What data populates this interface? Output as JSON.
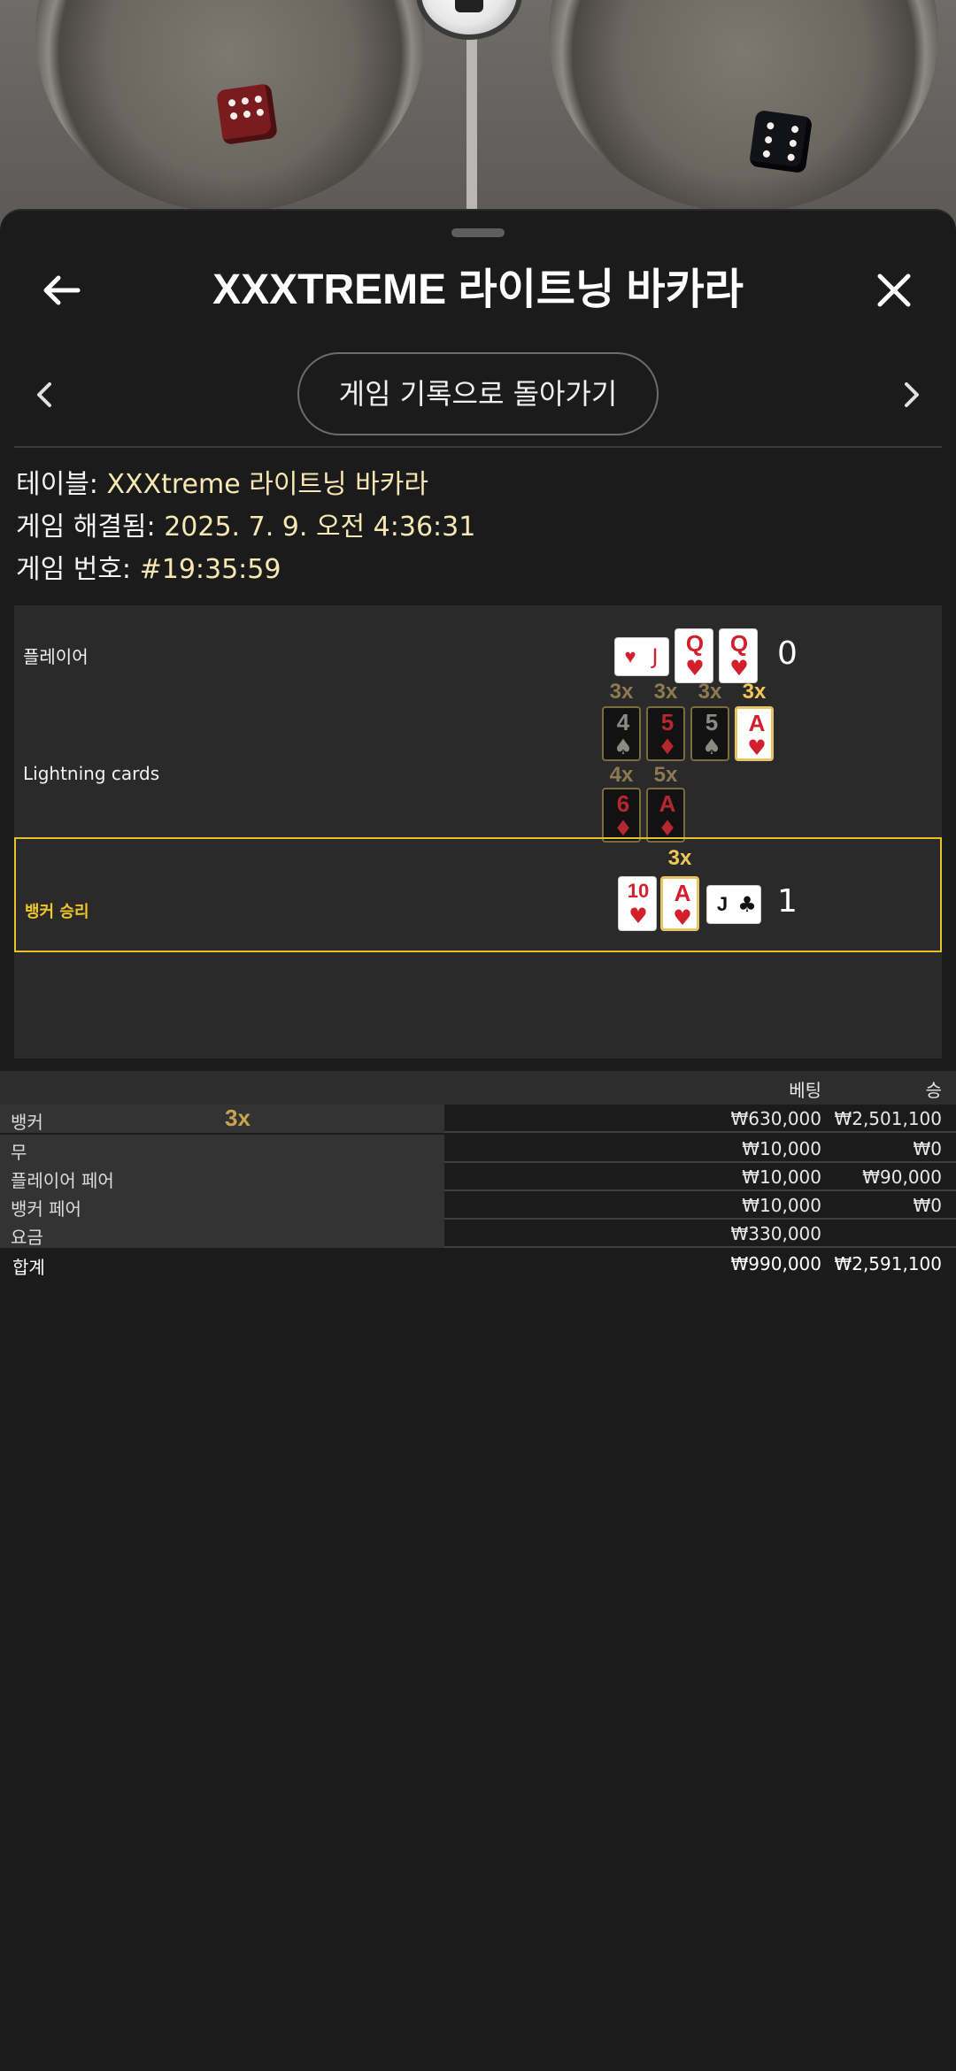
{
  "header": {
    "title": "XXXTREME 라이트닝 바카라"
  },
  "nav": {
    "history_button": "게임 기록으로 돌아가기"
  },
  "info": {
    "table_label": "테이블:",
    "table_value": "XXXtreme 라이트닝 바카라",
    "resolved_label": "게임 해결됨:",
    "resolved_value": "2025. 7. 9. 오전 4:36:31",
    "game_no_label": "게임 번호:",
    "game_no_value": "#19:35:59"
  },
  "result": {
    "player": {
      "label": "플레이어",
      "score": "0",
      "cards": [
        {
          "rank": "J",
          "suit": "♥",
          "color": "red",
          "orientation": "sideways"
        },
        {
          "rank": "Q",
          "suit": "♥",
          "color": "red"
        },
        {
          "rank": "Q",
          "suit": "♥",
          "color": "red"
        }
      ]
    },
    "lightning": {
      "label": "Lightning cards",
      "row1": [
        {
          "mult": "3x",
          "rank": "4",
          "suit": "♠",
          "color": "black"
        },
        {
          "mult": "3x",
          "rank": "5",
          "suit": "♦",
          "color": "red"
        },
        {
          "mult": "3x",
          "rank": "5",
          "suit": "♠",
          "color": "black"
        },
        {
          "mult": "3x",
          "rank": "A",
          "suit": "♥",
          "color": "red",
          "highlighted": true
        }
      ],
      "row2": [
        {
          "mult": "4x",
          "rank": "6",
          "suit": "♦",
          "color": "red"
        },
        {
          "mult": "5x",
          "rank": "A",
          "suit": "♦",
          "color": "red"
        }
      ]
    },
    "banker": {
      "label": "뱅커 승리",
      "score": "1",
      "mult": "3x",
      "cards": [
        {
          "rank": "10",
          "suit": "♥",
          "color": "red"
        },
        {
          "rank": "A",
          "suit": "♥",
          "color": "red",
          "highlighted": true
        },
        {
          "rank": "J",
          "suit": "♣",
          "color": "black",
          "orientation": "sideways"
        }
      ]
    }
  },
  "bets": {
    "header": {
      "bet": "베팅",
      "win": "승"
    },
    "rows": [
      {
        "name": "뱅커",
        "mult": "3x",
        "bet": "₩630,000",
        "win": "₩2,501,100"
      },
      {
        "name": "무",
        "bet": "₩10,000",
        "win": "₩0"
      },
      {
        "name": "플레이어 페어",
        "bet": "₩10,000",
        "win": "₩90,000"
      },
      {
        "name": "뱅커 페어",
        "bet": "₩10,000",
        "win": "₩0"
      },
      {
        "name": "요금",
        "bet": "₩330,000",
        "win": ""
      }
    ],
    "total": {
      "name": "합계",
      "bet": "₩990,000",
      "win": "₩2,591,100"
    }
  },
  "colors": {
    "highlight": "#e6c12e",
    "info_value": "#f6e7b3",
    "card_red": "#d21f2b"
  }
}
